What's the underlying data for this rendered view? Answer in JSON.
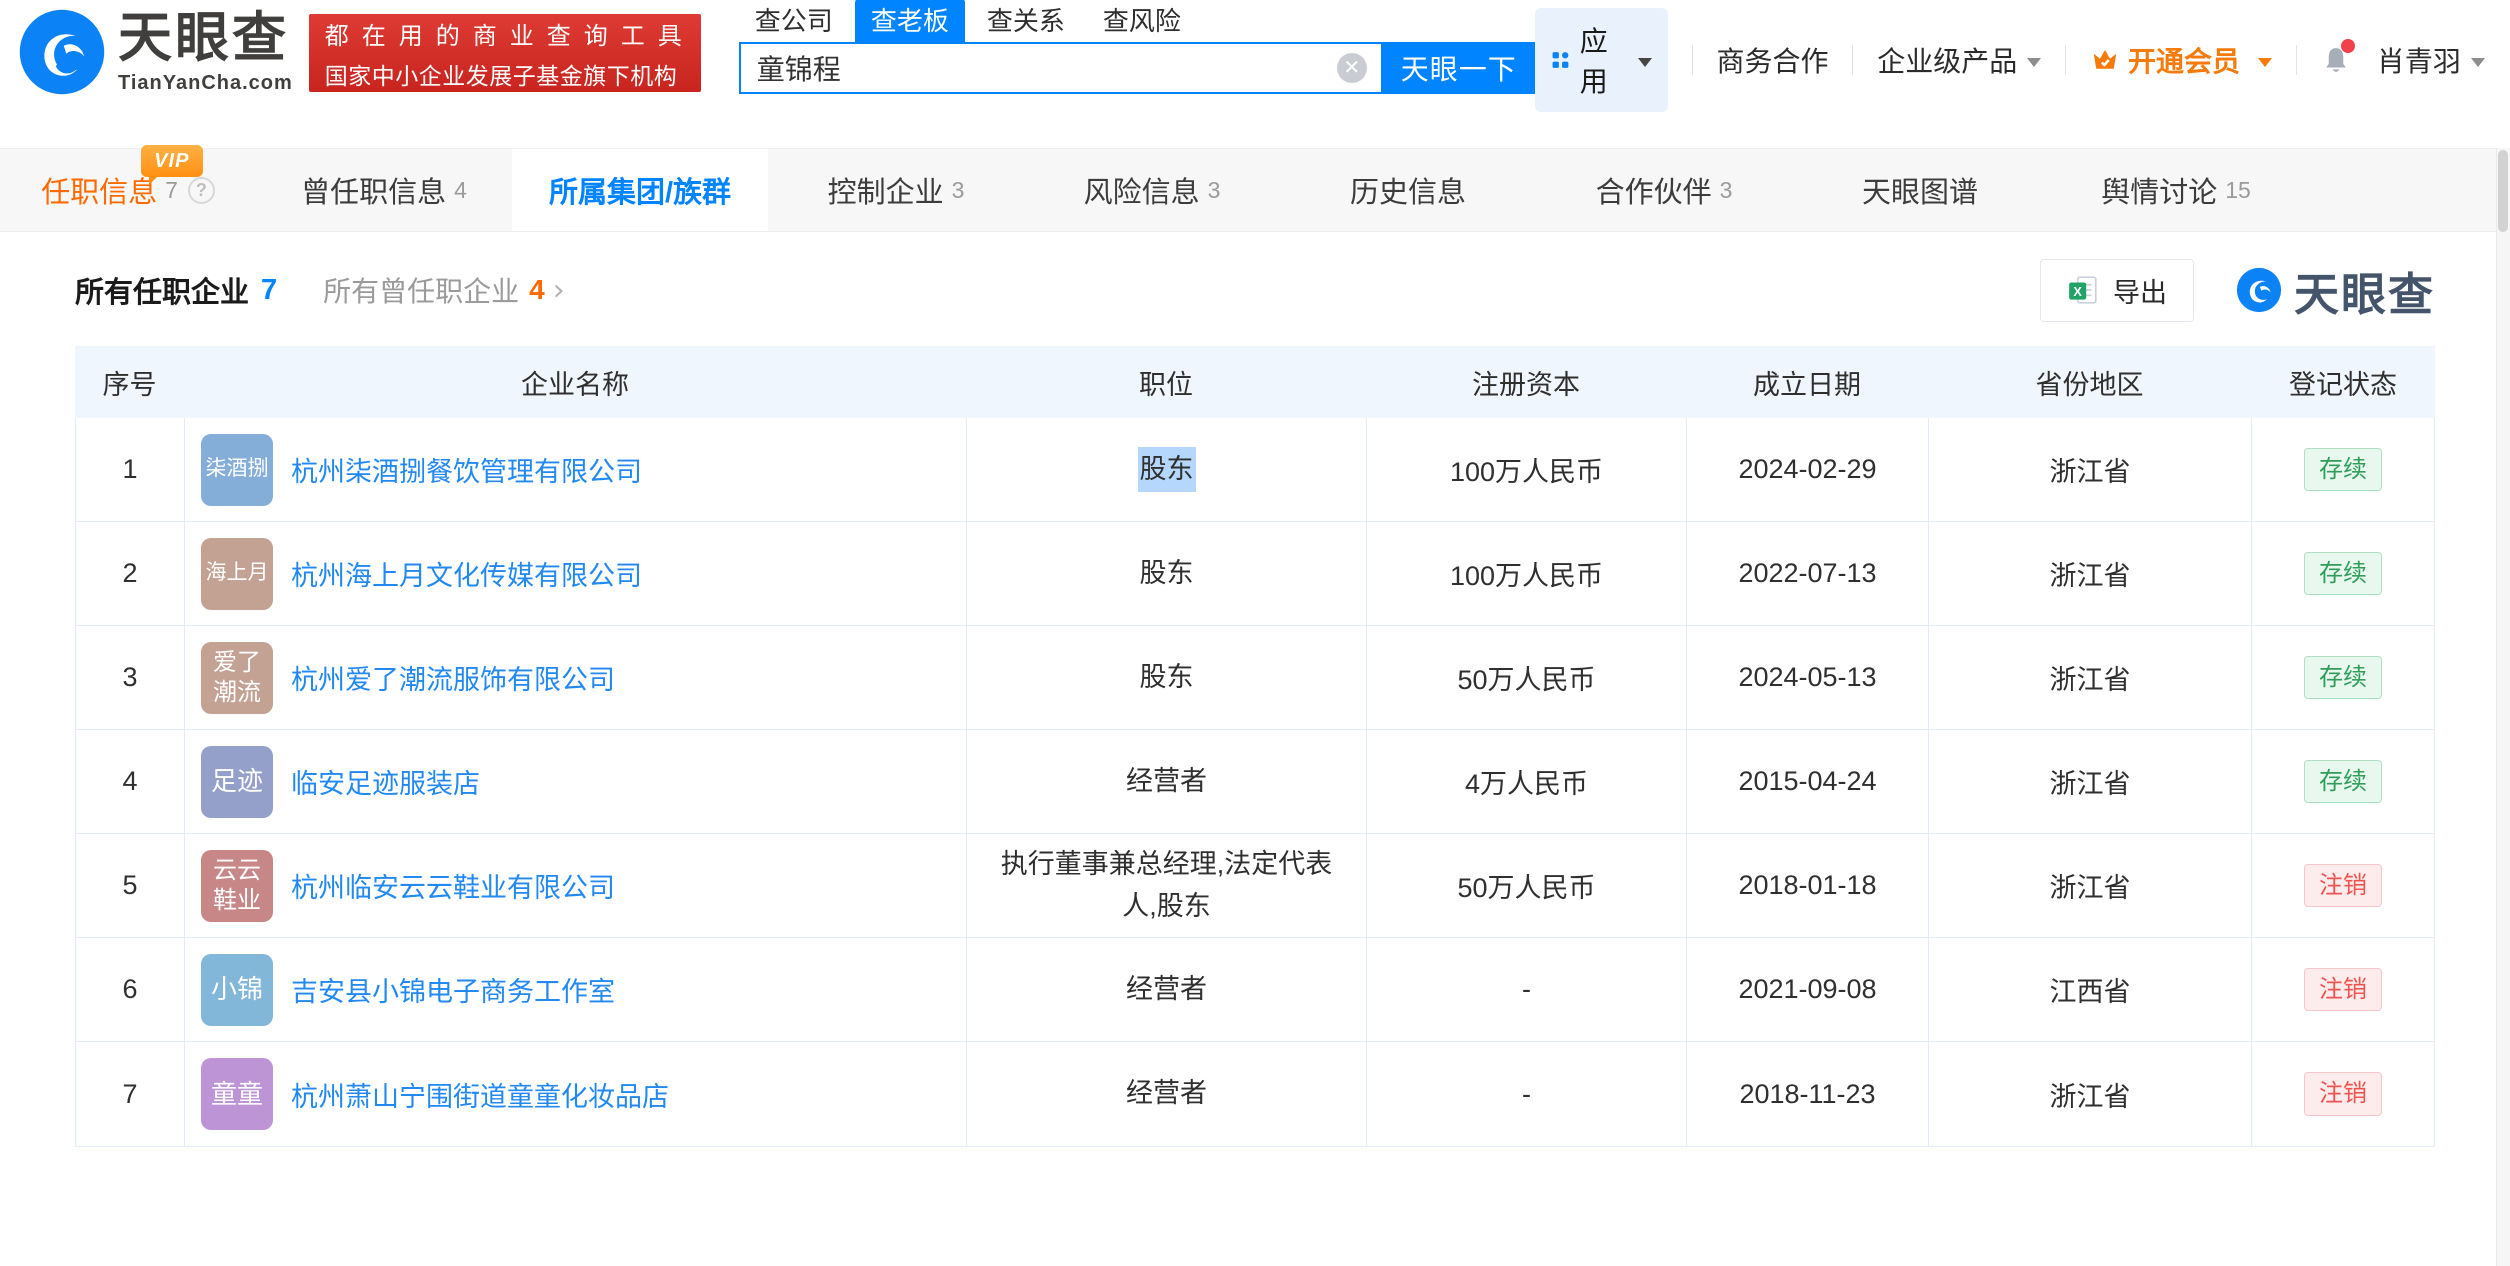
{
  "colors": {
    "accent_blue": "#0084ff",
    "link_blue": "#2289f2",
    "orange": "#ff6a00",
    "banner_red": "#d0302a",
    "status_active_green": "#2f9e58",
    "status_cancelled_red": "#f15353"
  },
  "icons": {
    "logo": "tianyancha-eye-icon",
    "apps": "grid-icon",
    "vip": "crown-icon",
    "bell": "bell-icon",
    "clear": "circle-x-icon",
    "export": "excel-icon",
    "help": "question-icon",
    "caret": "chevron-down-icon"
  },
  "header": {
    "logo": {
      "brand": "天眼查",
      "domain": "TianYanCha.com"
    },
    "promo": {
      "line1": "都在用的商业查询工具",
      "line2": "国家中小企业发展子基金旗下机构"
    },
    "search": {
      "tabs": [
        {
          "label": "查公司",
          "active": false
        },
        {
          "label": "查老板",
          "active": true
        },
        {
          "label": "查关系",
          "active": false
        },
        {
          "label": "查风险",
          "active": false
        }
      ],
      "value": "童锦程",
      "button": "天眼一下"
    },
    "nav": {
      "apps": "应用",
      "biz": "商务合作",
      "enterprise": "企业级产品",
      "vip": "开通会员",
      "user": "肖青羽"
    }
  },
  "badges": {
    "vip": "VIP"
  },
  "tabs": [
    {
      "label": "任职信息",
      "count": "7",
      "vip": true,
      "help": true
    },
    {
      "label": "曾任职信息",
      "count": "4"
    },
    {
      "label": "所属集团/族群",
      "active": true
    },
    {
      "label": "控制企业",
      "count": "3"
    },
    {
      "label": "风险信息",
      "count": "3"
    },
    {
      "label": "历史信息"
    },
    {
      "label": "合作伙伴",
      "count": "3"
    },
    {
      "label": "天眼图谱"
    },
    {
      "label": "舆情讨论",
      "count": "15"
    }
  ],
  "section": {
    "title": "所有任职企业",
    "title_count": "7",
    "secondary": "所有曾任职企业",
    "secondary_count": "4",
    "chevron": "›",
    "export": "导出",
    "watermark": "天眼查"
  },
  "table": {
    "columns": [
      "序号",
      "企业名称",
      "职位",
      "注册资本",
      "成立日期",
      "省份地区",
      "登记状态"
    ],
    "rows": [
      {
        "index": "1",
        "logo_text": "柒酒捌",
        "logo_color": "#84aed7",
        "name": "杭州柒酒捌餐饮管理有限公司",
        "position": "股东",
        "position_highlight": true,
        "capital": "100万人民币",
        "date": "2024-02-29",
        "province": "浙江省",
        "status": "存续",
        "status_type": "active"
      },
      {
        "index": "2",
        "logo_text": "海上月",
        "logo_color": "#c3a294",
        "name": "杭州海上月文化传媒有限公司",
        "position": "股东",
        "position_highlight": false,
        "capital": "100万人民币",
        "date": "2022-07-13",
        "province": "浙江省",
        "status": "存续",
        "status_type": "active"
      },
      {
        "index": "3",
        "logo_text": "爱了潮流",
        "logo_color": "#c3a294",
        "name": "杭州爱了潮流服饰有限公司",
        "position": "股东",
        "position_highlight": false,
        "capital": "50万人民币",
        "date": "2024-05-13",
        "province": "浙江省",
        "status": "存续",
        "status_type": "active"
      },
      {
        "index": "4",
        "logo_text": "足迹",
        "logo_color": "#94a0ca",
        "name": "临安足迹服装店",
        "position": "经营者",
        "position_highlight": false,
        "capital": "4万人民币",
        "date": "2015-04-24",
        "province": "浙江省",
        "status": "存续",
        "status_type": "active"
      },
      {
        "index": "5",
        "logo_text": "云云鞋业",
        "logo_color": "#c78787",
        "name": "杭州临安云云鞋业有限公司",
        "position": "执行董事兼总经理,法定代表人,股东",
        "position_highlight": false,
        "capital": "50万人民币",
        "date": "2018-01-18",
        "province": "浙江省",
        "status": "注销",
        "status_type": "cancelled"
      },
      {
        "index": "6",
        "logo_text": "小锦",
        "logo_color": "#83b7d9",
        "name": "吉安县小锦电子商务工作室",
        "position": "经营者",
        "position_highlight": false,
        "capital": "-",
        "date": "2021-09-08",
        "province": "江西省",
        "status": "注销",
        "status_type": "cancelled"
      },
      {
        "index": "7",
        "logo_text": "童童",
        "logo_color": "#bd94d6",
        "name": "杭州萧山宁围街道童童化妆品店",
        "position": "经营者",
        "position_highlight": false,
        "capital": "-",
        "date": "2018-11-23",
        "province": "浙江省",
        "status": "注销",
        "status_type": "cancelled"
      }
    ]
  }
}
